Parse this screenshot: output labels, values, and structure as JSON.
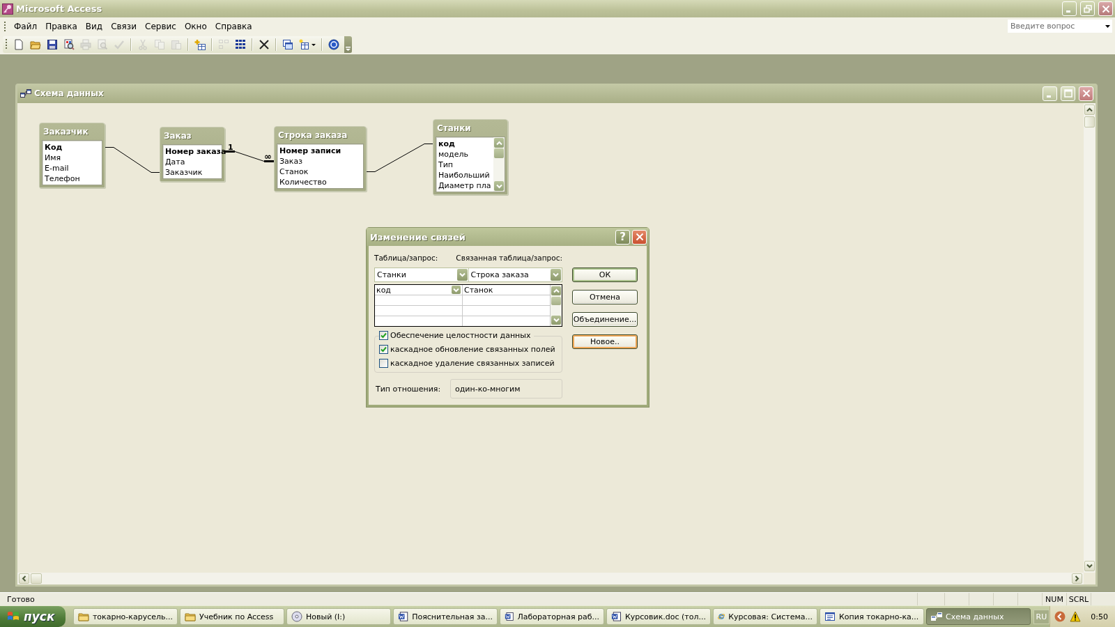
{
  "window": {
    "title": "Microsoft Access"
  },
  "menu": [
    {
      "label": "Файл"
    },
    {
      "label": "Правка"
    },
    {
      "label": "Вид"
    },
    {
      "label": "Связи"
    },
    {
      "label": "Сервис"
    },
    {
      "label": "Окно"
    },
    {
      "label": "Справка"
    }
  ],
  "help_search": {
    "placeholder": "Введите вопрос"
  },
  "toolbar": [
    [
      {
        "kind": "new",
        "disabled": false
      },
      {
        "kind": "open",
        "disabled": false
      },
      {
        "kind": "save",
        "disabled": false
      },
      {
        "kind": "file_search",
        "disabled": false
      },
      {
        "kind": "print",
        "disabled": true
      },
      {
        "kind": "preview",
        "disabled": true
      },
      {
        "kind": "spelling",
        "disabled": true
      }
    ],
    [
      {
        "kind": "cut",
        "disabled": true
      },
      {
        "kind": "copy",
        "disabled": true
      },
      {
        "kind": "paste",
        "disabled": true
      }
    ],
    [
      {
        "kind": "show_table",
        "disabled": false
      }
    ],
    [
      {
        "kind": "direct_relationships",
        "disabled": true
      },
      {
        "kind": "all_relationships",
        "disabled": false
      }
    ],
    [
      {
        "kind": "delete",
        "disabled": false
      }
    ],
    [
      {
        "kind": "database_window",
        "disabled": false
      },
      {
        "kind": "new_object",
        "disabled": false
      }
    ],
    [
      {
        "kind": "help",
        "disabled": false
      }
    ]
  ],
  "child_window": {
    "title": "Схема данных"
  },
  "tables": [
    {
      "title": "Заказчик",
      "scrollbar": false,
      "fields": [
        {
          "name": "Код",
          "key": true
        },
        {
          "name": "Имя",
          "key": false
        },
        {
          "name": "E-mail",
          "key": false
        },
        {
          "name": "Телефон",
          "key": false
        }
      ]
    },
    {
      "title": "Заказ",
      "scrollbar": false,
      "fields": [
        {
          "name": "Номер заказа",
          "key": true
        },
        {
          "name": "Дата",
          "key": false
        },
        {
          "name": "Заказчик",
          "key": false
        }
      ]
    },
    {
      "title": "Строка заказа",
      "scrollbar": false,
      "fields": [
        {
          "name": "Номер записи",
          "key": true
        },
        {
          "name": "Заказ",
          "key": false
        },
        {
          "name": "Станок",
          "key": false
        },
        {
          "name": "Количество",
          "key": false
        }
      ]
    },
    {
      "title": "Станки",
      "scrollbar": true,
      "fields": [
        {
          "name": "код",
          "key": true
        },
        {
          "name": "модель",
          "key": false
        },
        {
          "name": "Тип",
          "key": false
        },
        {
          "name": "Наибольший",
          "key": false
        },
        {
          "name": "Диаметр пла",
          "key": false
        }
      ]
    }
  ],
  "relationships": [
    {
      "enforced": false
    },
    {
      "enforced": true,
      "one_label": "1",
      "many_label": "∞"
    },
    {
      "enforced": false
    }
  ],
  "dialog": {
    "title": "Изменение связей",
    "help_button": "?",
    "table_label": "Таблица/запрос:",
    "related_label": "Связанная таблица/запрос:",
    "table_value": "Станки",
    "related_value": "Строка заказа",
    "field_pairs": [
      {
        "left": "код",
        "right": "Станок"
      }
    ],
    "checkboxes": [
      {
        "label": "Обеспечение целостности данных",
        "checked": true
      },
      {
        "label": "каскадное обновление связанных полей",
        "checked": true
      },
      {
        "label": "каскадное удаление связанных записей",
        "checked": false
      }
    ],
    "relation_type_label": "Тип отношения:",
    "relation_type": "один-ко-многим",
    "buttons": [
      {
        "label": "ОК",
        "default": true,
        "hot": false
      },
      {
        "label": "Отмена",
        "default": false,
        "hot": false
      },
      {
        "label": "Объединение...",
        "default": false,
        "hot": false
      },
      {
        "label": "Новое..",
        "default": false,
        "hot": true
      }
    ]
  },
  "status_bar": {
    "text": "Готово",
    "indicators": [
      {
        "label": "NUM"
      },
      {
        "label": "SCRL"
      }
    ]
  },
  "taskbar": {
    "start": "пуск",
    "tasks": [
      {
        "label": "токарно-карусель...",
        "kind": "folder",
        "selected": false
      },
      {
        "label": "Учебник по Access",
        "kind": "folder",
        "selected": false
      },
      {
        "label": "Новый (I:)",
        "kind": "disc",
        "selected": false
      },
      {
        "label": "Пояснительная за...",
        "kind": "word",
        "selected": false
      },
      {
        "label": "Лабораторная раб...",
        "kind": "word",
        "selected": false
      },
      {
        "label": "Курсовик.doc (тол...",
        "kind": "word",
        "selected": false
      },
      {
        "label": "Курсовая: Система...",
        "kind": "browser",
        "selected": false
      },
      {
        "label": "Копия токарно-ка...",
        "kind": "form",
        "selected": false
      },
      {
        "label": "Схема данных",
        "kind": "diagram",
        "selected": true
      }
    ],
    "language": "RU",
    "time": "0:50"
  }
}
